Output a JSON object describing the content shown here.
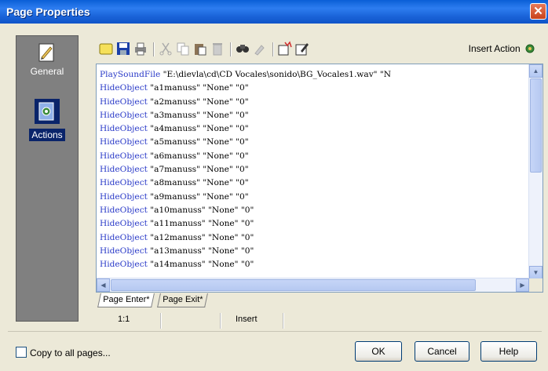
{
  "window": {
    "title": "Page Properties",
    "close_symbol": "✕"
  },
  "sidebar": {
    "items": [
      {
        "label": "General",
        "icon": "general-page-icon"
      },
      {
        "label": "Actions",
        "icon": "actions-gear-icon",
        "active": true
      }
    ]
  },
  "toolbar": {
    "buttons": [
      "new-action-icon",
      "save-icon",
      "print-icon",
      "cut-icon",
      "copy-icon",
      "paste-icon",
      "delete-icon",
      "find-icon",
      "replace-icon",
      "insert-script-icon",
      "edit-icon"
    ],
    "insert_action_label": "Insert Action"
  },
  "editor": {
    "lines": [
      {
        "cmd": "PlaySoundFile",
        "args": " \"E:\\dievla\\cd\\CD Vocales\\sonido\\BG_Vocales1.wav\" \"N"
      },
      {
        "cmd": "HideObject",
        "args": " \"a1manuss\" \"None\" \"0\""
      },
      {
        "cmd": "HideObject",
        "args": " \"a2manuss\" \"None\" \"0\""
      },
      {
        "cmd": "HideObject",
        "args": " \"a3manuss\" \"None\" \"0\""
      },
      {
        "cmd": "HideObject",
        "args": " \"a4manuss\" \"None\" \"0\""
      },
      {
        "cmd": "HideObject",
        "args": " \"a5manuss\" \"None\" \"0\""
      },
      {
        "cmd": "HideObject",
        "args": " \"a6manuss\" \"None\" \"0\""
      },
      {
        "cmd": "HideObject",
        "args": " \"a7manuss\" \"None\" \"0\""
      },
      {
        "cmd": "HideObject",
        "args": " \"a8manuss\" \"None\" \"0\""
      },
      {
        "cmd": "HideObject",
        "args": " \"a9manuss\" \"None\" \"0\""
      },
      {
        "cmd": "HideObject",
        "args": " \"a10manuss\" \"None\" \"0\""
      },
      {
        "cmd": "HideObject",
        "args": " \"a11manuss\" \"None\" \"0\""
      },
      {
        "cmd": "HideObject",
        "args": " \"a12manuss\" \"None\" \"0\""
      },
      {
        "cmd": "HideObject",
        "args": " \"a13manuss\" \"None\" \"0\""
      },
      {
        "cmd": "HideObject",
        "args": " \"a14manuss\" \"None\" \"0\""
      }
    ]
  },
  "tabs": [
    {
      "label": "Page Enter*",
      "active": true
    },
    {
      "label": "Page Exit*",
      "active": false
    }
  ],
  "status": {
    "position": "1:1",
    "mode": "Insert"
  },
  "footer": {
    "copy_to_all_label": "Copy to all pages...",
    "ok_label": "OK",
    "cancel_label": "Cancel",
    "help_label": "Help"
  },
  "colors": {
    "keyword": "#2a3ac8",
    "title_bar": "#0a5fd6",
    "active_item": "#0a246a"
  }
}
